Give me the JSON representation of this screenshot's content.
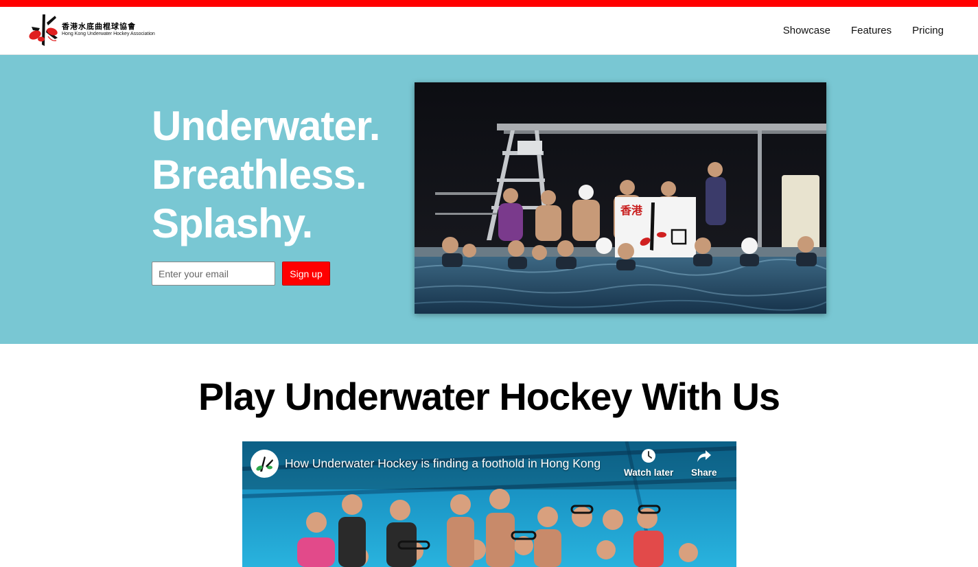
{
  "brand": {
    "name_cn": "香港水底曲棍球協會",
    "name_en": "Hong Kong Underwater Hockey Association",
    "colors": {
      "accent": "#ff0000",
      "hero_bg": "#79c7d3"
    }
  },
  "nav": {
    "links": [
      {
        "label": "Showcase"
      },
      {
        "label": "Features"
      },
      {
        "label": "Pricing"
      }
    ]
  },
  "hero": {
    "headline": [
      "Underwater.",
      "Breathless.",
      "Splashy."
    ],
    "email_placeholder": "Enter your email",
    "signup_label": "Sign up",
    "banner_text": "香港"
  },
  "section": {
    "title": "Play Underwater Hockey With Us"
  },
  "video": {
    "title": "How Underwater Hockey is finding a foothold in Hong Kong",
    "watch_later_label": "Watch later",
    "share_label": "Share",
    "icons": [
      "clock-icon",
      "share-icon"
    ]
  }
}
